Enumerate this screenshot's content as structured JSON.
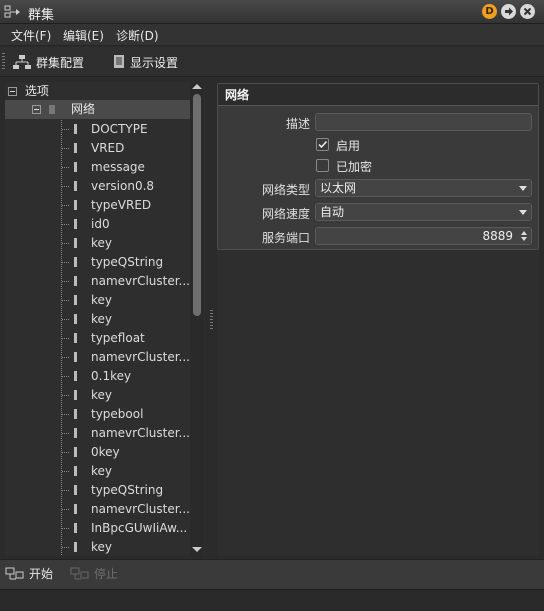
{
  "window": {
    "title": "群集",
    "buttons": {
      "d_label": "D"
    }
  },
  "menu": [
    "文件(F)",
    "编辑(E)",
    "诊断(D)"
  ],
  "toolbar": {
    "cluster_config": "群集配置",
    "display_settings": "显示设置"
  },
  "tree": {
    "root": "选项",
    "network": "网络",
    "items": [
      "DOCTYPE",
      "VRED",
      "message",
      "version0.8",
      "typeVRED",
      "id0",
      "key",
      "typeQString",
      "namevrCluster...",
      "key",
      "key",
      "typefloat",
      "namevrCluster...",
      "0.1key",
      "key",
      "typebool",
      "namevrCluster...",
      "0key",
      "key",
      "typeQString",
      "namevrCluster...",
      "InBpcGUwIiAw...",
      "key"
    ]
  },
  "network": {
    "title": "网络",
    "description_label": "描述",
    "description_value": "",
    "enabled_label": "启用",
    "enabled": true,
    "encrypted_label": "已加密",
    "encrypted": false,
    "type_label": "网络类型",
    "type_value": "以太网",
    "speed_label": "网络速度",
    "speed_value": "自动",
    "port_label": "服务端口",
    "port_value": "8889"
  },
  "actions": {
    "start": "开始",
    "stop": "停止"
  },
  "colors": {
    "background": "#2b2b2b",
    "panel": "#3a3a3a",
    "selected_row": "#4a4a4a",
    "badge": "#f0a020"
  }
}
